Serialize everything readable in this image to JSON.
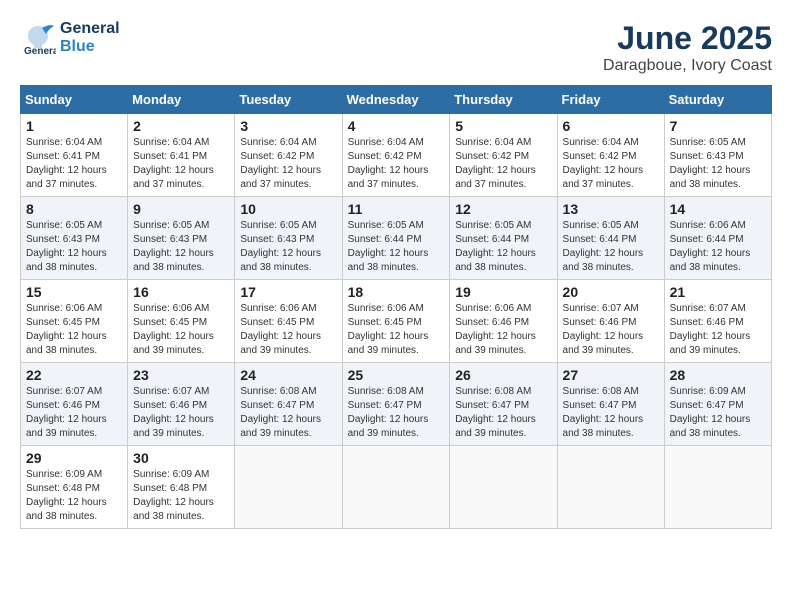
{
  "header": {
    "logo_general": "General",
    "logo_blue": "Blue",
    "month": "June 2025",
    "location": "Daragboue, Ivory Coast"
  },
  "days_of_week": [
    "Sunday",
    "Monday",
    "Tuesday",
    "Wednesday",
    "Thursday",
    "Friday",
    "Saturday"
  ],
  "weeks": [
    [
      {
        "day": "1",
        "sunrise": "Sunrise: 6:04 AM",
        "sunset": "Sunset: 6:41 PM",
        "daylight": "Daylight: 12 hours and 37 minutes."
      },
      {
        "day": "2",
        "sunrise": "Sunrise: 6:04 AM",
        "sunset": "Sunset: 6:41 PM",
        "daylight": "Daylight: 12 hours and 37 minutes."
      },
      {
        "day": "3",
        "sunrise": "Sunrise: 6:04 AM",
        "sunset": "Sunset: 6:42 PM",
        "daylight": "Daylight: 12 hours and 37 minutes."
      },
      {
        "day": "4",
        "sunrise": "Sunrise: 6:04 AM",
        "sunset": "Sunset: 6:42 PM",
        "daylight": "Daylight: 12 hours and 37 minutes."
      },
      {
        "day": "5",
        "sunrise": "Sunrise: 6:04 AM",
        "sunset": "Sunset: 6:42 PM",
        "daylight": "Daylight: 12 hours and 37 minutes."
      },
      {
        "day": "6",
        "sunrise": "Sunrise: 6:04 AM",
        "sunset": "Sunset: 6:42 PM",
        "daylight": "Daylight: 12 hours and 37 minutes."
      },
      {
        "day": "7",
        "sunrise": "Sunrise: 6:05 AM",
        "sunset": "Sunset: 6:43 PM",
        "daylight": "Daylight: 12 hours and 38 minutes."
      }
    ],
    [
      {
        "day": "8",
        "sunrise": "Sunrise: 6:05 AM",
        "sunset": "Sunset: 6:43 PM",
        "daylight": "Daylight: 12 hours and 38 minutes."
      },
      {
        "day": "9",
        "sunrise": "Sunrise: 6:05 AM",
        "sunset": "Sunset: 6:43 PM",
        "daylight": "Daylight: 12 hours and 38 minutes."
      },
      {
        "day": "10",
        "sunrise": "Sunrise: 6:05 AM",
        "sunset": "Sunset: 6:43 PM",
        "daylight": "Daylight: 12 hours and 38 minutes."
      },
      {
        "day": "11",
        "sunrise": "Sunrise: 6:05 AM",
        "sunset": "Sunset: 6:44 PM",
        "daylight": "Daylight: 12 hours and 38 minutes."
      },
      {
        "day": "12",
        "sunrise": "Sunrise: 6:05 AM",
        "sunset": "Sunset: 6:44 PM",
        "daylight": "Daylight: 12 hours and 38 minutes."
      },
      {
        "day": "13",
        "sunrise": "Sunrise: 6:05 AM",
        "sunset": "Sunset: 6:44 PM",
        "daylight": "Daylight: 12 hours and 38 minutes."
      },
      {
        "day": "14",
        "sunrise": "Sunrise: 6:06 AM",
        "sunset": "Sunset: 6:44 PM",
        "daylight": "Daylight: 12 hours and 38 minutes."
      }
    ],
    [
      {
        "day": "15",
        "sunrise": "Sunrise: 6:06 AM",
        "sunset": "Sunset: 6:45 PM",
        "daylight": "Daylight: 12 hours and 38 minutes."
      },
      {
        "day": "16",
        "sunrise": "Sunrise: 6:06 AM",
        "sunset": "Sunset: 6:45 PM",
        "daylight": "Daylight: 12 hours and 39 minutes."
      },
      {
        "day": "17",
        "sunrise": "Sunrise: 6:06 AM",
        "sunset": "Sunset: 6:45 PM",
        "daylight": "Daylight: 12 hours and 39 minutes."
      },
      {
        "day": "18",
        "sunrise": "Sunrise: 6:06 AM",
        "sunset": "Sunset: 6:45 PM",
        "daylight": "Daylight: 12 hours and 39 minutes."
      },
      {
        "day": "19",
        "sunrise": "Sunrise: 6:06 AM",
        "sunset": "Sunset: 6:46 PM",
        "daylight": "Daylight: 12 hours and 39 minutes."
      },
      {
        "day": "20",
        "sunrise": "Sunrise: 6:07 AM",
        "sunset": "Sunset: 6:46 PM",
        "daylight": "Daylight: 12 hours and 39 minutes."
      },
      {
        "day": "21",
        "sunrise": "Sunrise: 6:07 AM",
        "sunset": "Sunset: 6:46 PM",
        "daylight": "Daylight: 12 hours and 39 minutes."
      }
    ],
    [
      {
        "day": "22",
        "sunrise": "Sunrise: 6:07 AM",
        "sunset": "Sunset: 6:46 PM",
        "daylight": "Daylight: 12 hours and 39 minutes."
      },
      {
        "day": "23",
        "sunrise": "Sunrise: 6:07 AM",
        "sunset": "Sunset: 6:46 PM",
        "daylight": "Daylight: 12 hours and 39 minutes."
      },
      {
        "day": "24",
        "sunrise": "Sunrise: 6:08 AM",
        "sunset": "Sunset: 6:47 PM",
        "daylight": "Daylight: 12 hours and 39 minutes."
      },
      {
        "day": "25",
        "sunrise": "Sunrise: 6:08 AM",
        "sunset": "Sunset: 6:47 PM",
        "daylight": "Daylight: 12 hours and 39 minutes."
      },
      {
        "day": "26",
        "sunrise": "Sunrise: 6:08 AM",
        "sunset": "Sunset: 6:47 PM",
        "daylight": "Daylight: 12 hours and 39 minutes."
      },
      {
        "day": "27",
        "sunrise": "Sunrise: 6:08 AM",
        "sunset": "Sunset: 6:47 PM",
        "daylight": "Daylight: 12 hours and 38 minutes."
      },
      {
        "day": "28",
        "sunrise": "Sunrise: 6:09 AM",
        "sunset": "Sunset: 6:47 PM",
        "daylight": "Daylight: 12 hours and 38 minutes."
      }
    ],
    [
      {
        "day": "29",
        "sunrise": "Sunrise: 6:09 AM",
        "sunset": "Sunset: 6:48 PM",
        "daylight": "Daylight: 12 hours and 38 minutes."
      },
      {
        "day": "30",
        "sunrise": "Sunrise: 6:09 AM",
        "sunset": "Sunset: 6:48 PM",
        "daylight": "Daylight: 12 hours and 38 minutes."
      },
      {
        "day": "",
        "sunrise": "",
        "sunset": "",
        "daylight": ""
      },
      {
        "day": "",
        "sunrise": "",
        "sunset": "",
        "daylight": ""
      },
      {
        "day": "",
        "sunrise": "",
        "sunset": "",
        "daylight": ""
      },
      {
        "day": "",
        "sunrise": "",
        "sunset": "",
        "daylight": ""
      },
      {
        "day": "",
        "sunrise": "",
        "sunset": "",
        "daylight": ""
      }
    ]
  ]
}
